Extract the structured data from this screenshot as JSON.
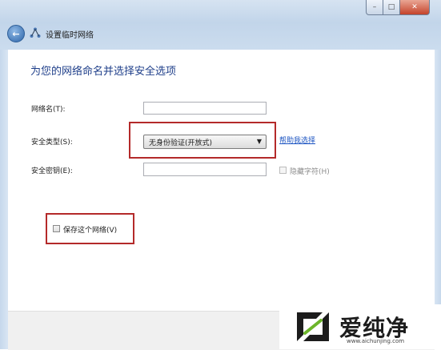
{
  "window": {
    "title": "设置临时网络",
    "caption_buttons": {
      "minimize": "–",
      "maximize": "□",
      "close": "✕"
    },
    "icons": {
      "back": "back-arrow-icon",
      "wizard": "network-wizard-icon"
    }
  },
  "form": {
    "heading": "为您的网络命名并选择安全选项",
    "network_name_label": "网络名(T):",
    "network_name_value": "",
    "security_type_label": "安全类型(S):",
    "security_type_selected": "无身份验证(开放式)",
    "help_link": "帮助我选择",
    "security_key_label": "安全密钥(E):",
    "security_key_value": "",
    "hide_chars_label": "隐藏字符(H)",
    "hide_chars_checked": false,
    "save_network_label": "保存这个网络(V)",
    "save_network_checked": false
  },
  "watermark": {
    "brand": "爱纯净",
    "url": "www.aichunjing.com"
  },
  "colors": {
    "heading": "#1f3f8a",
    "link": "#1d55c2",
    "highlight_box": "#b42a2a",
    "glass": "#c8d9ec"
  }
}
